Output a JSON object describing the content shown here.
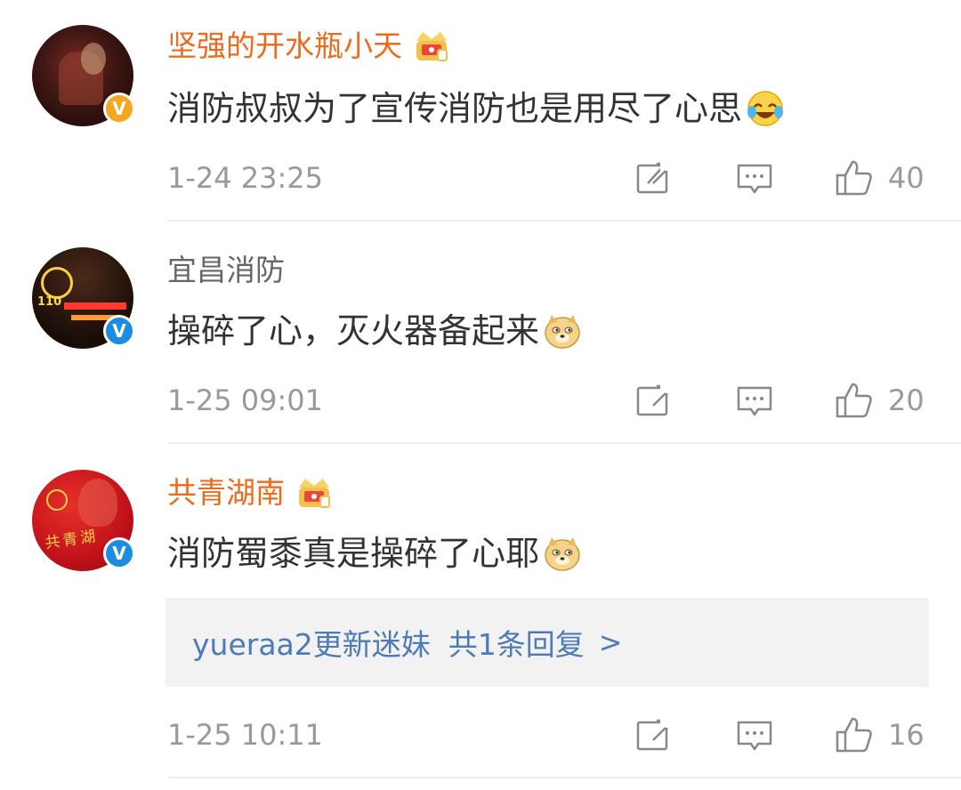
{
  "comments": [
    {
      "username": "坚强的开水瓶小天",
      "name_color": "orange",
      "verified": "gold",
      "has_crown": true,
      "text": "消防叔叔为了宣传消防也是用尽了心思",
      "emoji": "laughing-crying-emoji",
      "time": "1-24 23:25",
      "likes": "40"
    },
    {
      "username": "宜昌消防",
      "name_color": "gray",
      "verified": "blue",
      "has_crown": false,
      "text": "操碎了心，灭火器备起来",
      "emoji": "doge-emoji",
      "time": "1-25 09:01",
      "likes": "20"
    },
    {
      "username": "共青湖南",
      "name_color": "orange",
      "verified": "blue",
      "has_crown": true,
      "text": "消防蜀黍真是操碎了心耶",
      "emoji": "doge-emoji",
      "reply": {
        "user": "yueraa2更新迷妹",
        "count_label": "共1条回复",
        "chevron": ">"
      },
      "time": "1-25 10:11",
      "likes": "16"
    }
  ],
  "avatar_texts": {
    "c2": "110",
    "c3": "共青湖"
  },
  "colors": {
    "name_orange": "#ee6a1a",
    "reply_link": "#4e7ab5",
    "meta_gray": "#999999"
  }
}
